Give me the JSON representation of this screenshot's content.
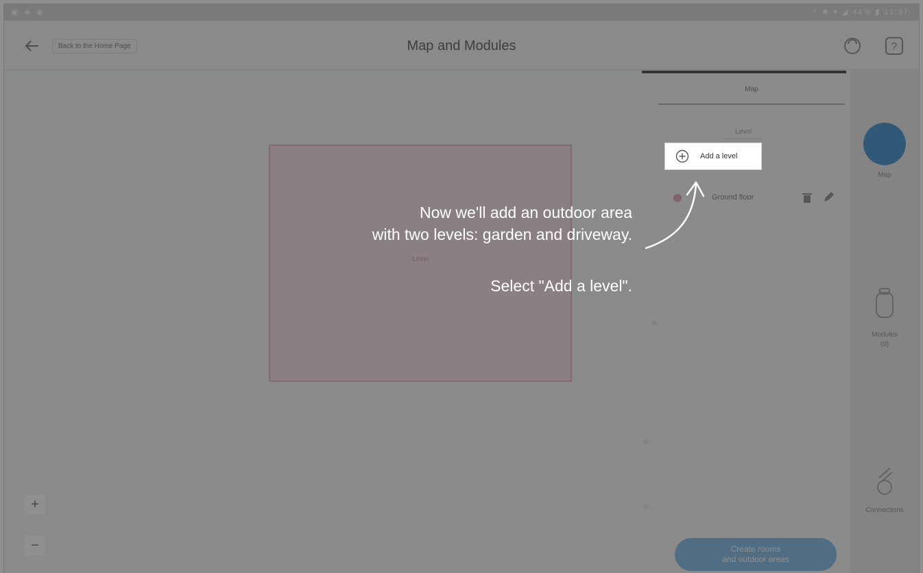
{
  "status_bar": {
    "left_icons": [
      "notification-icon",
      "photo-icon",
      "image-icon"
    ],
    "right_text": "⚡ ✱ ▾ ◢ 44% ▮ 11:37"
  },
  "header": {
    "back_label": "Back to the Home Page",
    "title": "Map and Modules",
    "icons": [
      "support-icon",
      "help-icon"
    ]
  },
  "canvas": {
    "room_label": "Level",
    "zoom_in": "+",
    "zoom_out": "−"
  },
  "panel": {
    "tab_label": "Map",
    "ghost_level": "Level",
    "add_level_label": "Add a level",
    "level_row_label": "Ground floor",
    "cta_line1": "Create rooms",
    "cta_line2": "and outdoor areas"
  },
  "vertical_nav": {
    "items": [
      {
        "label": "Map",
        "icon": "map-icon"
      },
      {
        "label": "Modules",
        "label2": "(0)",
        "icon": "module-icon"
      },
      {
        "label": "Connections",
        "icon": "connections-icon"
      }
    ]
  },
  "tutorial": {
    "line1": "Now we'll add an outdoor area",
    "line2": "with two levels: garden and driveway.",
    "instruction": "Select \"Add a level\"."
  },
  "colors": {
    "accent": "#5a9ed6",
    "cta": "#8fc3ea",
    "room_fill": "#f6e4ea",
    "room_border": "#ebb9c7",
    "overlay": "rgba(0,0,0,0.44)"
  }
}
